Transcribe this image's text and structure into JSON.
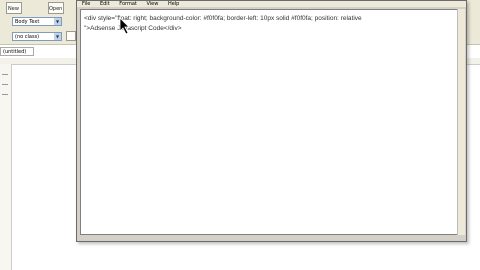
{
  "toolbar": {
    "new_label": "New",
    "open_label": "Open",
    "style_value": "Body Text",
    "class_value": "(no class)"
  },
  "document": {
    "tab_label": "(untitled)"
  },
  "editor": {
    "menu": [
      "File",
      "Edit",
      "Format",
      "View",
      "Help"
    ],
    "content": "<div style=\"float: right; background-color: #f0f0fa; border-left: 10px solid #f0f0fa; position: relative\n\">Adsense Javascript Code</div>"
  }
}
